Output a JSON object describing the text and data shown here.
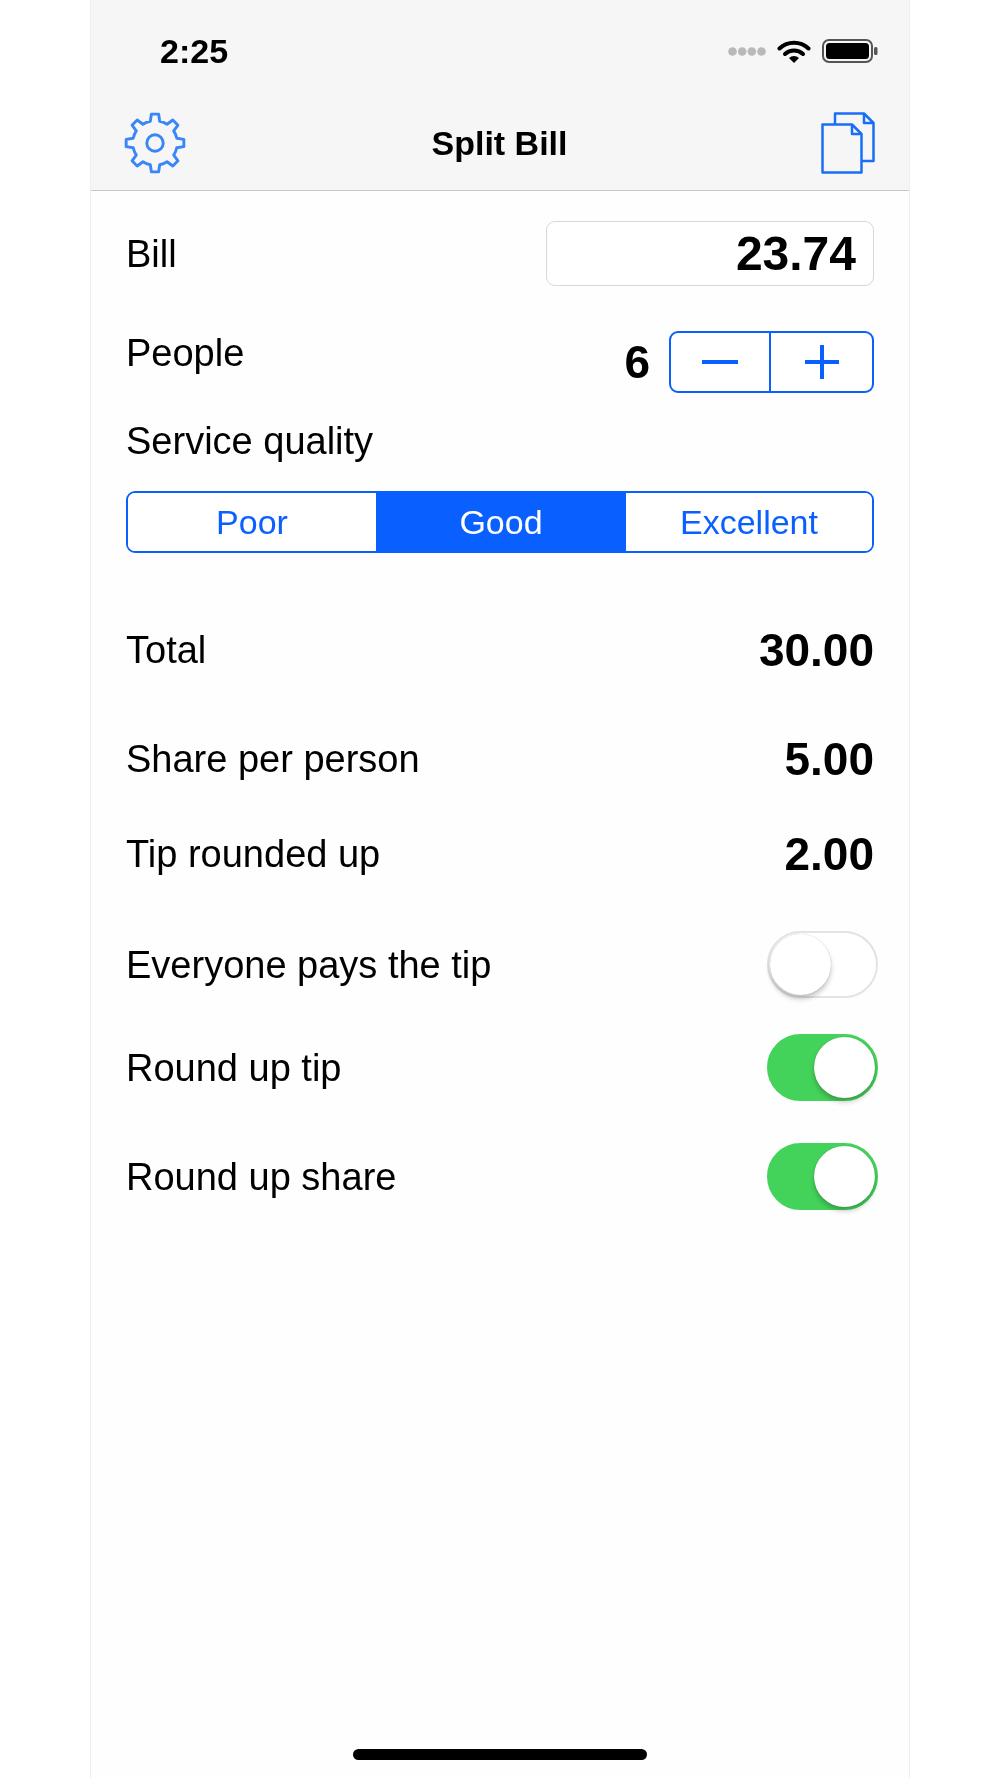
{
  "status_bar": {
    "time": "2:25"
  },
  "nav_bar": {
    "title": "Split Bill"
  },
  "bill": {
    "label": "Bill",
    "value": "23.74"
  },
  "people": {
    "label": "People",
    "count": "6"
  },
  "service_quality": {
    "label": "Service quality",
    "options": [
      {
        "label": "Poor",
        "selected": false
      },
      {
        "label": "Good",
        "selected": true
      },
      {
        "label": "Excellent",
        "selected": false
      }
    ]
  },
  "results": [
    {
      "label": "Total",
      "value": "30.00"
    },
    {
      "label": "Share per person",
      "value": "5.00"
    },
    {
      "label": "Tip rounded up",
      "value": "2.00"
    }
  ],
  "toggles": [
    {
      "label": "Everyone pays the tip",
      "on": false
    },
    {
      "label": "Round up tip",
      "on": true
    },
    {
      "label": "Round up share",
      "on": true
    }
  ]
}
